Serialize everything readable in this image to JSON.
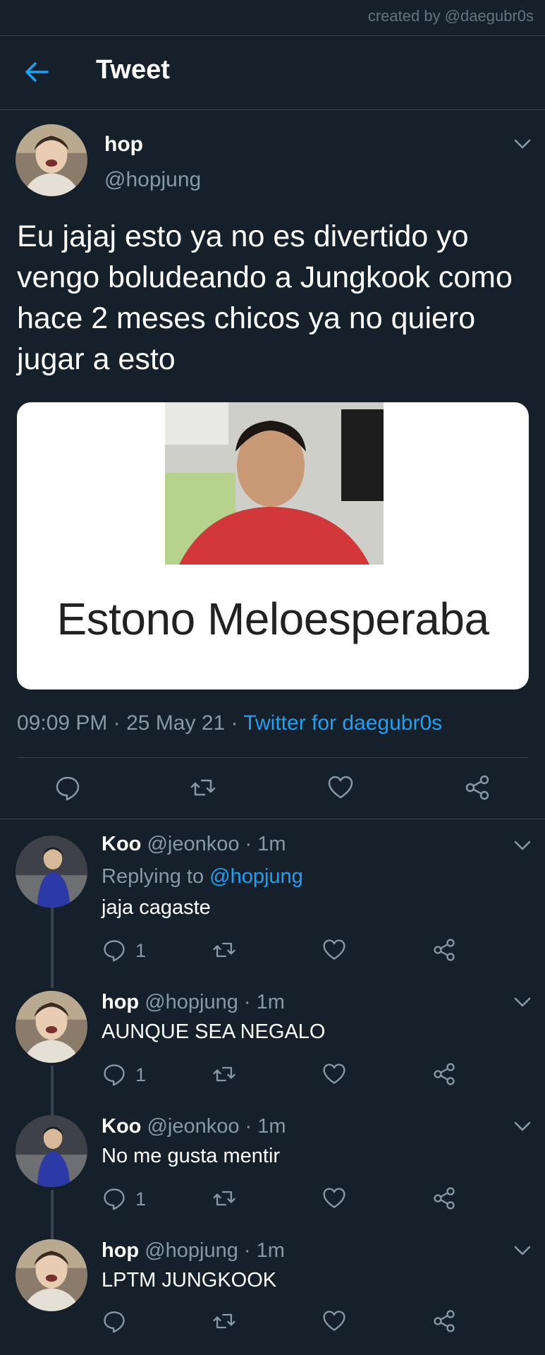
{
  "credit": "created by @daegubr0s",
  "appbar": {
    "title": "Tweet"
  },
  "main_tweet": {
    "name": "hop",
    "handle": "@hopjung",
    "text": "Eu jajaj esto ya no es divertido yo vengo boludeando a Jungkook como hace 2 meses chicos ya no quiero jugar a esto",
    "media_caption": "Estono Meloesperaba",
    "time": "09:09 PM",
    "date": "25 May 21",
    "source": "Twitter for daegubr0s",
    "separator": "·"
  },
  "icons": {
    "back": "arrow-left-icon",
    "more": "chevron-down-icon",
    "reply": "reply-icon",
    "retweet": "retweet-icon",
    "like": "heart-icon",
    "share": "share-icon"
  },
  "replies": [
    {
      "name": "Koo",
      "meta": "@jeonkoo · 1m",
      "replying_label": "Replying to",
      "replying_to": "@hopjung",
      "text": "jaja cagaste",
      "reply_count": "1"
    },
    {
      "name": "hop",
      "meta": "@hopjung · 1m",
      "text": "AUNQUE SEA NEGALO",
      "reply_count": "1"
    },
    {
      "name": "Koo",
      "meta": "@jeonkoo · 1m",
      "text": "No me gusta mentir",
      "reply_count": "1"
    },
    {
      "name": "hop",
      "meta": "@hopjung · 1m",
      "text": "LPTM JUNGKOOK",
      "reply_count": ""
    }
  ],
  "colors": {
    "background": "#15202b",
    "accent": "#1da1f2",
    "secondary_text": "#8899a6",
    "divider": "#38444d"
  }
}
